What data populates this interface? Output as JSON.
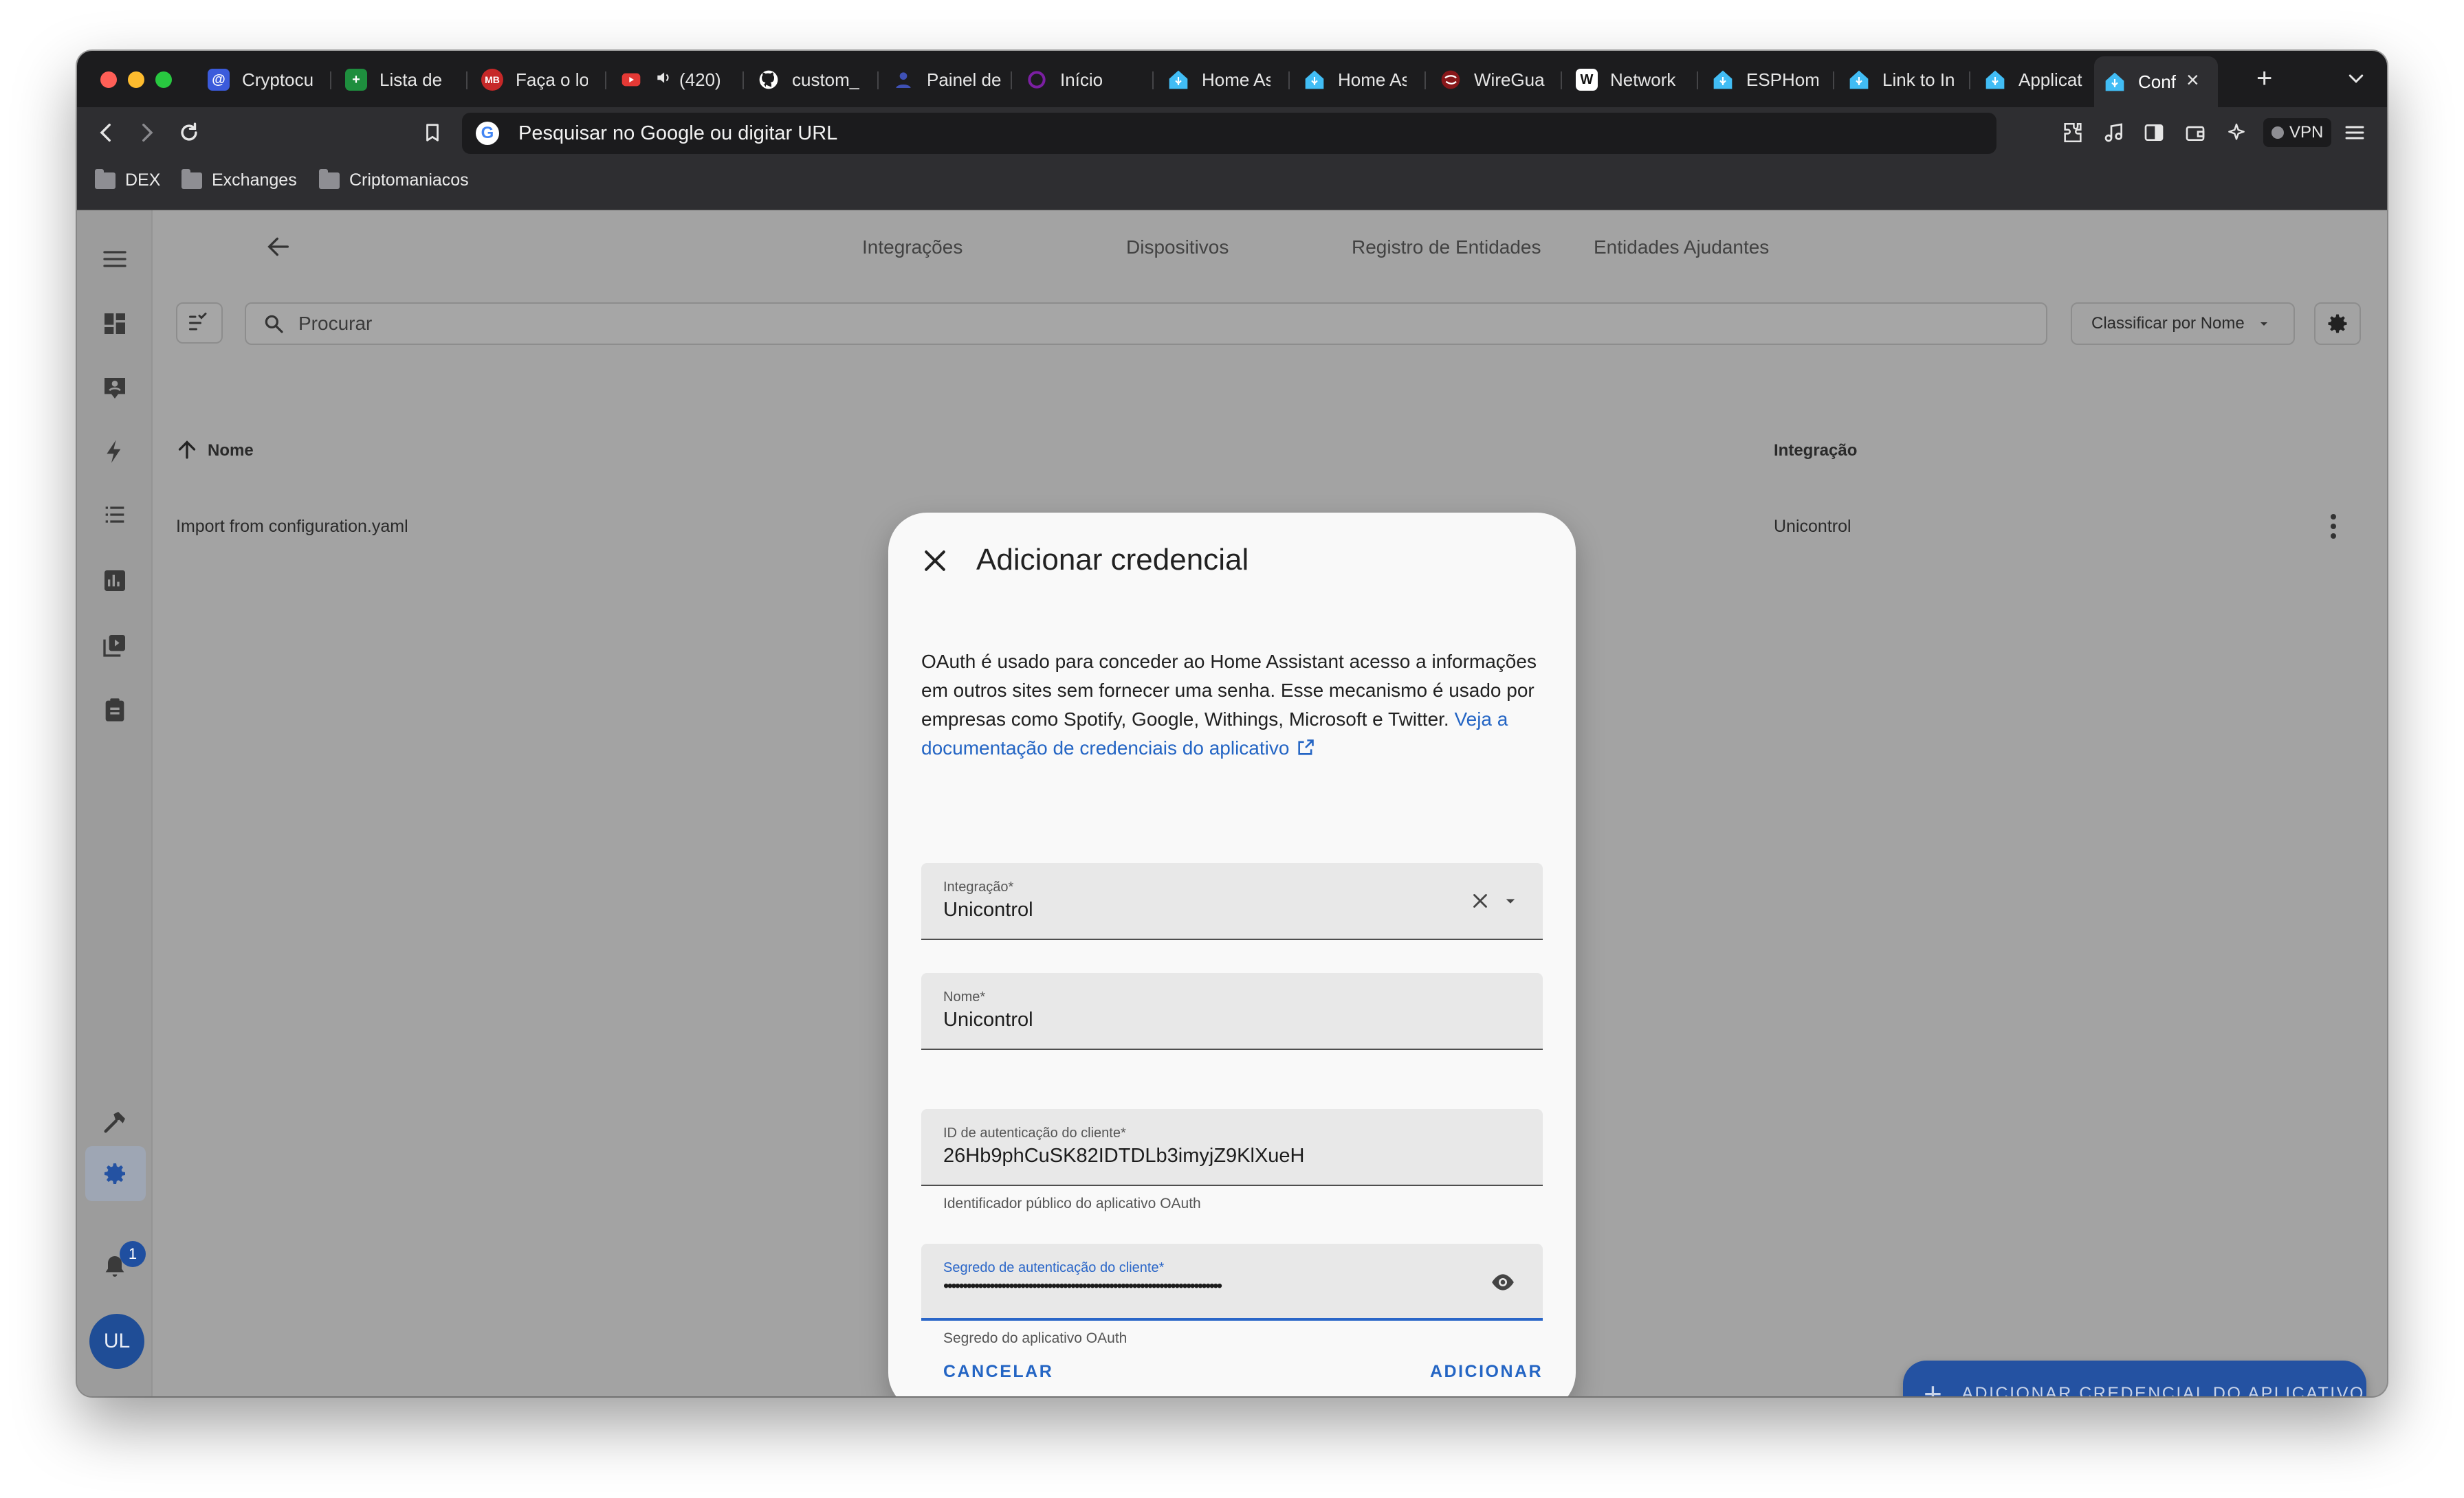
{
  "browser": {
    "tabs": [
      {
        "label": "Cryptocu",
        "icon": "coin-icon",
        "color": "#3b5bdb"
      },
      {
        "label": "Lista de",
        "icon": "sheets-icon",
        "color": "#1e8e3e"
      },
      {
        "label": "Faça o lo",
        "icon": "mb-icon",
        "color": "#c62828"
      },
      {
        "label": "(420)",
        "icon": "youtube-icon",
        "color": "#e53935"
      },
      {
        "label": "custom_",
        "icon": "github-icon",
        "color": "#ffffff"
      },
      {
        "label": "Painel de",
        "icon": "person-icon",
        "color": "#3f51b5"
      },
      {
        "label": "Início",
        "icon": "ring-icon",
        "color": "#7b1fa2"
      },
      {
        "label": "Home As",
        "icon": "home-assistant-icon",
        "color": "#41bdf5"
      },
      {
        "label": "Home As",
        "icon": "home-assistant-icon",
        "color": "#41bdf5"
      },
      {
        "label": "WireGua",
        "icon": "wireguard-icon",
        "color": "#88171a"
      },
      {
        "label": "Network",
        "icon": "wikipedia-icon",
        "color": "#ffffff"
      },
      {
        "label": "ESPHom",
        "icon": "home-assistant-icon",
        "color": "#41bdf5"
      },
      {
        "label": "Link to In",
        "icon": "home-assistant-icon",
        "color": "#41bdf5"
      },
      {
        "label": "Applicat",
        "icon": "home-assistant-icon",
        "color": "#41bdf5"
      },
      {
        "label": "Conf",
        "icon": "home-assistant-icon",
        "color": "#41bdf5"
      }
    ],
    "url_placeholder": "Pesquisar no Google ou digitar URL",
    "vpn_label": "VPN",
    "bookmarks": [
      "DEX",
      "Exchanges",
      "Criptomaniacos"
    ]
  },
  "ha": {
    "nav_tabs": [
      "Integrações",
      "Dispositivos",
      "Registro de Entidades",
      "Entidades Ajudantes"
    ],
    "search_placeholder": "Procurar",
    "sort_label": "Classificar por Nome",
    "columns": {
      "name": "Nome",
      "integration": "Integração"
    },
    "rows": [
      {
        "name": "Import from configuration.yaml",
        "integration": "Unicontrol"
      }
    ],
    "notification_count": "1",
    "avatar_initials": "UL",
    "fab_label": "ADICIONAR CREDENCIAL DO APLICATIVO",
    "accent_color": "#2452a2"
  },
  "dialog": {
    "title": "Adicionar credencial",
    "description": "OAuth é usado para conceder ao Home Assistant acesso a informações em outros sites sem fornecer uma senha. Esse mecanismo é usado por empresas como Spotify, Google, Withings, Microsoft e Twitter.",
    "doc_link": "Veja a documentação de credenciais do aplicativo",
    "fields": {
      "integration": {
        "label": "Integração*",
        "value": "Unicontrol"
      },
      "name": {
        "label": "Nome*",
        "value": "Unicontrol"
      },
      "client_id": {
        "label": "ID de autenticação do cliente*",
        "value": "26Hb9phCuSK82IDTDLb3imyjZ9KlXueH",
        "helper": "Identificador público do aplicativo OAuth"
      },
      "client_secret": {
        "label": "Segredo de autenticação do cliente*",
        "value": "••••••••••••••••••••••••••••••••••••••••••••••••••••••••••••••••••••••••",
        "helper": "Segredo do aplicativo OAuth"
      }
    },
    "cancel_label": "CANCELAR",
    "add_label": "ADICIONAR",
    "link_color": "#2465c4"
  }
}
